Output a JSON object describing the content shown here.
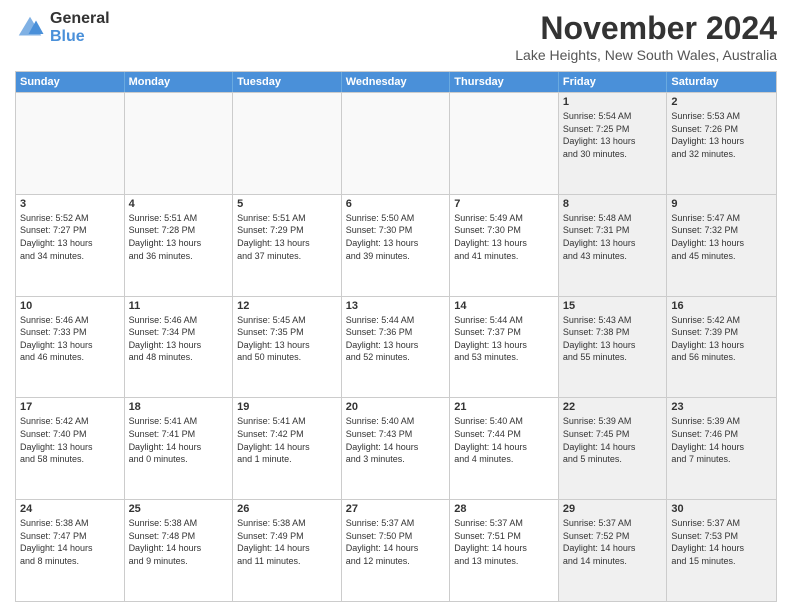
{
  "logo": {
    "general": "General",
    "blue": "Blue"
  },
  "title": {
    "month": "November 2024",
    "location": "Lake Heights, New South Wales, Australia"
  },
  "header_days": [
    "Sunday",
    "Monday",
    "Tuesday",
    "Wednesday",
    "Thursday",
    "Friday",
    "Saturday"
  ],
  "weeks": [
    [
      {
        "day": "",
        "info": "",
        "empty": true
      },
      {
        "day": "",
        "info": "",
        "empty": true
      },
      {
        "day": "",
        "info": "",
        "empty": true
      },
      {
        "day": "",
        "info": "",
        "empty": true
      },
      {
        "day": "",
        "info": "",
        "empty": true
      },
      {
        "day": "1",
        "info": "Sunrise: 5:54 AM\nSunset: 7:25 PM\nDaylight: 13 hours\nand 30 minutes.",
        "shaded": true
      },
      {
        "day": "2",
        "info": "Sunrise: 5:53 AM\nSunset: 7:26 PM\nDaylight: 13 hours\nand 32 minutes.",
        "shaded": true
      }
    ],
    [
      {
        "day": "3",
        "info": "Sunrise: 5:52 AM\nSunset: 7:27 PM\nDaylight: 13 hours\nand 34 minutes."
      },
      {
        "day": "4",
        "info": "Sunrise: 5:51 AM\nSunset: 7:28 PM\nDaylight: 13 hours\nand 36 minutes."
      },
      {
        "day": "5",
        "info": "Sunrise: 5:51 AM\nSunset: 7:29 PM\nDaylight: 13 hours\nand 37 minutes."
      },
      {
        "day": "6",
        "info": "Sunrise: 5:50 AM\nSunset: 7:30 PM\nDaylight: 13 hours\nand 39 minutes."
      },
      {
        "day": "7",
        "info": "Sunrise: 5:49 AM\nSunset: 7:30 PM\nDaylight: 13 hours\nand 41 minutes."
      },
      {
        "day": "8",
        "info": "Sunrise: 5:48 AM\nSunset: 7:31 PM\nDaylight: 13 hours\nand 43 minutes.",
        "shaded": true
      },
      {
        "day": "9",
        "info": "Sunrise: 5:47 AM\nSunset: 7:32 PM\nDaylight: 13 hours\nand 45 minutes.",
        "shaded": true
      }
    ],
    [
      {
        "day": "10",
        "info": "Sunrise: 5:46 AM\nSunset: 7:33 PM\nDaylight: 13 hours\nand 46 minutes."
      },
      {
        "day": "11",
        "info": "Sunrise: 5:46 AM\nSunset: 7:34 PM\nDaylight: 13 hours\nand 48 minutes."
      },
      {
        "day": "12",
        "info": "Sunrise: 5:45 AM\nSunset: 7:35 PM\nDaylight: 13 hours\nand 50 minutes."
      },
      {
        "day": "13",
        "info": "Sunrise: 5:44 AM\nSunset: 7:36 PM\nDaylight: 13 hours\nand 52 minutes."
      },
      {
        "day": "14",
        "info": "Sunrise: 5:44 AM\nSunset: 7:37 PM\nDaylight: 13 hours\nand 53 minutes."
      },
      {
        "day": "15",
        "info": "Sunrise: 5:43 AM\nSunset: 7:38 PM\nDaylight: 13 hours\nand 55 minutes.",
        "shaded": true
      },
      {
        "day": "16",
        "info": "Sunrise: 5:42 AM\nSunset: 7:39 PM\nDaylight: 13 hours\nand 56 minutes.",
        "shaded": true
      }
    ],
    [
      {
        "day": "17",
        "info": "Sunrise: 5:42 AM\nSunset: 7:40 PM\nDaylight: 13 hours\nand 58 minutes."
      },
      {
        "day": "18",
        "info": "Sunrise: 5:41 AM\nSunset: 7:41 PM\nDaylight: 14 hours\nand 0 minutes."
      },
      {
        "day": "19",
        "info": "Sunrise: 5:41 AM\nSunset: 7:42 PM\nDaylight: 14 hours\nand 1 minute."
      },
      {
        "day": "20",
        "info": "Sunrise: 5:40 AM\nSunset: 7:43 PM\nDaylight: 14 hours\nand 3 minutes."
      },
      {
        "day": "21",
        "info": "Sunrise: 5:40 AM\nSunset: 7:44 PM\nDaylight: 14 hours\nand 4 minutes."
      },
      {
        "day": "22",
        "info": "Sunrise: 5:39 AM\nSunset: 7:45 PM\nDaylight: 14 hours\nand 5 minutes.",
        "shaded": true
      },
      {
        "day": "23",
        "info": "Sunrise: 5:39 AM\nSunset: 7:46 PM\nDaylight: 14 hours\nand 7 minutes.",
        "shaded": true
      }
    ],
    [
      {
        "day": "24",
        "info": "Sunrise: 5:38 AM\nSunset: 7:47 PM\nDaylight: 14 hours\nand 8 minutes."
      },
      {
        "day": "25",
        "info": "Sunrise: 5:38 AM\nSunset: 7:48 PM\nDaylight: 14 hours\nand 9 minutes."
      },
      {
        "day": "26",
        "info": "Sunrise: 5:38 AM\nSunset: 7:49 PM\nDaylight: 14 hours\nand 11 minutes."
      },
      {
        "day": "27",
        "info": "Sunrise: 5:37 AM\nSunset: 7:50 PM\nDaylight: 14 hours\nand 12 minutes."
      },
      {
        "day": "28",
        "info": "Sunrise: 5:37 AM\nSunset: 7:51 PM\nDaylight: 14 hours\nand 13 minutes."
      },
      {
        "day": "29",
        "info": "Sunrise: 5:37 AM\nSunset: 7:52 PM\nDaylight: 14 hours\nand 14 minutes.",
        "shaded": true
      },
      {
        "day": "30",
        "info": "Sunrise: 5:37 AM\nSunset: 7:53 PM\nDaylight: 14 hours\nand 15 minutes.",
        "shaded": true
      }
    ]
  ]
}
